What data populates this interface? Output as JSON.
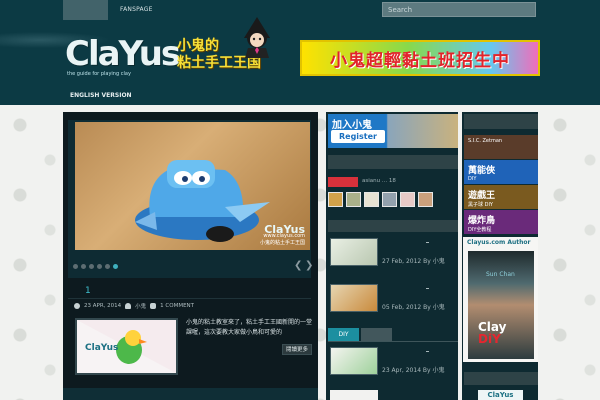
{
  "header": {
    "fanspage_label": "FANSPAGE",
    "search_placeholder": "Search",
    "logo_word": "ClaYus",
    "logo_tagline": "the guide for playing clay",
    "logo_cn": "小鬼的\n粘土手工王国",
    "banner_text": "小鬼超輕黏土班招生中",
    "nav_english": "ENGLISH VERSION"
  },
  "slider": {
    "watermark_brand": "ClaYus",
    "watermark_url": "www.clayus.com",
    "watermark_cn": "小鬼的粘土手工王国",
    "dots_total": 6,
    "dots_active_index": 5,
    "prev_icon": "❮",
    "next_icon": "❯"
  },
  "featured_post": {
    "title_mark": "1",
    "date": "23 APR, 2014",
    "author": "小鬼",
    "comments": "1 COMMENT",
    "excerpt": "小鬼的粘土教室來了，粘土手工王國新開的一堂課喔，這次要教大家做小鳥和可愛的",
    "read_more": "閱讀更多"
  },
  "join": {
    "title": "加入小鬼",
    "subtitle": "Register"
  },
  "fanbox": {
    "name": "asianu ... 18"
  },
  "sidebar_posts": [
    {
      "date": "27 Feb, 2012 By 小鬼"
    },
    {
      "date": "05 Feb, 2012 By 小鬼"
    },
    {
      "date": "23 Apr, 2014 By 小鬼"
    }
  ],
  "tabs": [
    {
      "label": "DIY"
    },
    {
      "label": ""
    }
  ],
  "right_ads": [
    {
      "title": "",
      "sub": "S.I.C. Zetman",
      "color": "#5a3c2a"
    },
    {
      "title": "萬能俠",
      "sub": "DIY",
      "color": "#1f63b8"
    },
    {
      "title": "遊戲王",
      "sub": "黑子球 DIY",
      "color": "#7a5a1f"
    },
    {
      "title": "爆炸鳥",
      "sub": "DIY全教程",
      "color": "#6a2a7a"
    }
  ],
  "author_card": {
    "title": "Clayus.com Author",
    "name": "Sun Chan",
    "logo_top": "Clay",
    "logo_bottom": "DiY"
  },
  "right_bottom_logo": "ClaYus"
}
